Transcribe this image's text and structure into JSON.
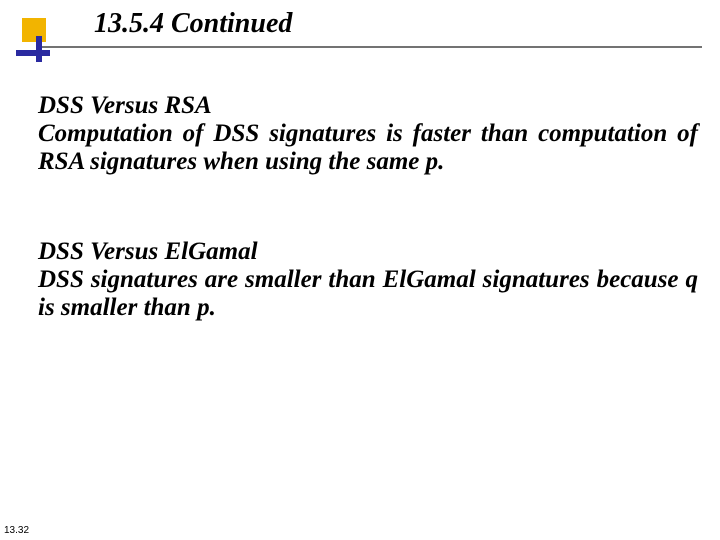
{
  "title": "13.5.4  Continued",
  "section1": {
    "heading": "DSS Versus RSA",
    "body": "Computation of DSS signatures is faster than computation of RSA signatures when using the same p."
  },
  "section2": {
    "heading": "DSS Versus ElGamal",
    "body": "DSS signatures are smaller than ElGamal signatures because q is smaller than p."
  },
  "page_number": "13.32"
}
